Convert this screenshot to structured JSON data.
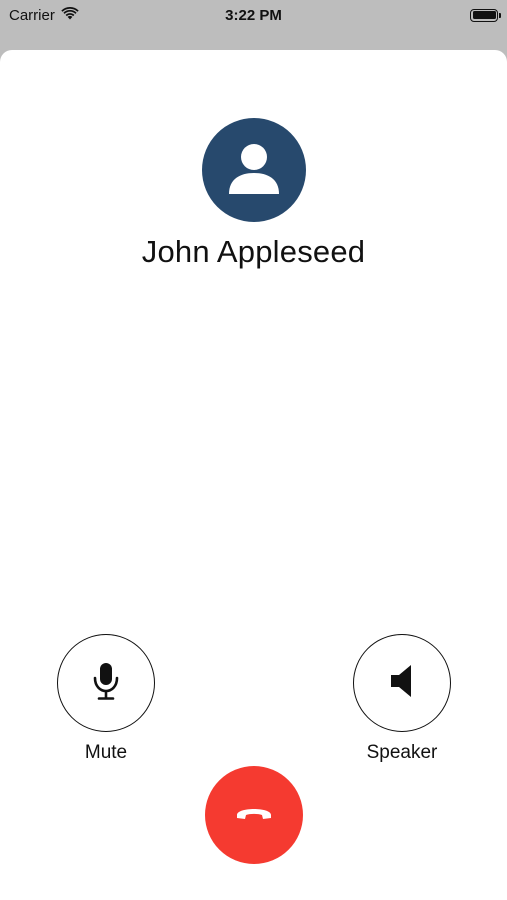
{
  "status_bar": {
    "carrier": "Carrier",
    "time": "3:22 PM",
    "icons": [
      "wifi-icon",
      "battery-icon"
    ]
  },
  "call": {
    "caller_name": "John Appleseed",
    "avatar_icon": "person-icon",
    "avatar_color": "#27496d"
  },
  "controls": {
    "mute_label": "Mute",
    "mute_icon": "microphone-icon",
    "speaker_label": "Speaker",
    "speaker_icon": "speaker-icon",
    "end_call_icon": "phone-hangup-icon",
    "end_call_color": "#f53a30"
  }
}
